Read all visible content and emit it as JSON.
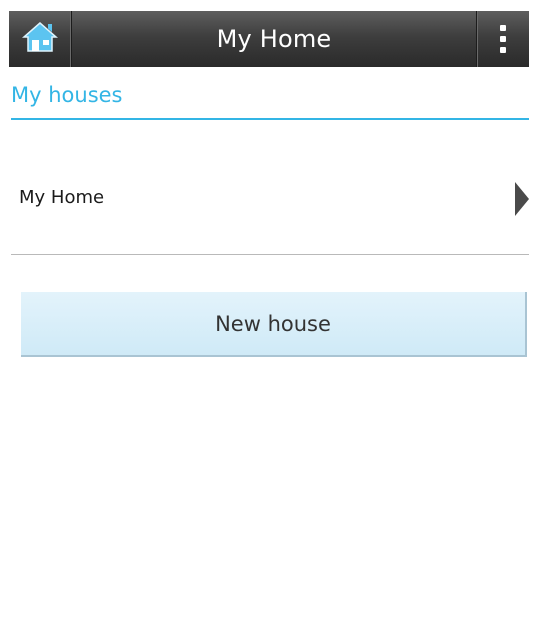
{
  "actionbar": {
    "title": "My Home",
    "home_icon": "home-icon",
    "overflow_icon": "overflow-menu-icon",
    "home_icon_color": "#5cc4f0"
  },
  "section": {
    "title": "My houses",
    "accent_color": "#33b5e5"
  },
  "houses": {
    "items": [
      {
        "label": "My Home",
        "icon": "chevron-right-icon"
      }
    ]
  },
  "new_house_button": {
    "label": "New house",
    "background": "#d4edf8"
  }
}
